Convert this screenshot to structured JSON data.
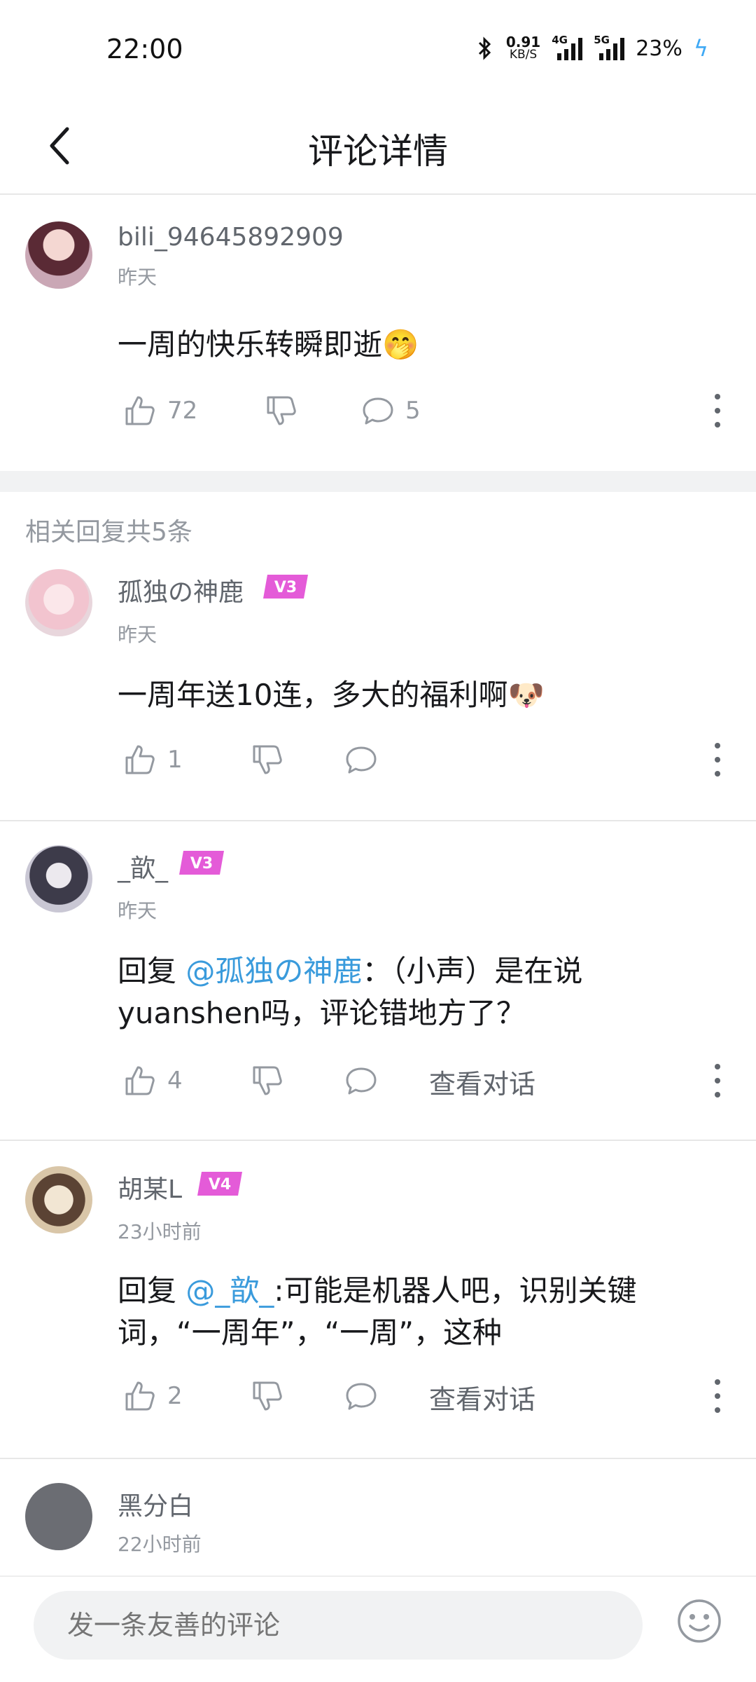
{
  "status_bar": {
    "time": "22:00",
    "net_speed": "0.91",
    "net_unit": "KB/S",
    "sim1": "4G",
    "sim2": "5G",
    "battery": "23%"
  },
  "header": {
    "title": "评论详情"
  },
  "main_comment": {
    "username": "bili_94645892909",
    "time": "昨天",
    "text": "一周的快乐转瞬即逝",
    "emoji": "🤭",
    "likes": "72",
    "replies": "5"
  },
  "section_title": "相关回复共5条",
  "replies": [
    {
      "username": "孤独の神鹿",
      "level": "V3",
      "time": "昨天",
      "text": "一周年送10连，多大的福利啊",
      "emoji": "🐶",
      "likes": "1"
    },
    {
      "username": "_歆_",
      "level": "V3",
      "time": "昨天",
      "reply_prefix": "回复 ",
      "mention": "@孤独の神鹿",
      "text": "：（小声）是在说yuanshen吗，评论错地方了？",
      "likes": "4",
      "view_conversation": "查看对话"
    },
    {
      "username": "胡某L",
      "level": "V4",
      "time": "23小时前",
      "reply_prefix": "回复 ",
      "mention": "@_歆_",
      "text": ":可能是机器人吧，识别关键词，“一周年”，“一周”，这种",
      "likes": "2",
      "view_conversation": "查看对话"
    },
    {
      "username": "黑分白",
      "time": "22小时前"
    }
  ],
  "bottom_bar": {
    "placeholder": "发一条友善的评论"
  },
  "colors": {
    "mention": "#3a9bdc",
    "level_badge": "#e45bd8",
    "divider": "#f1f2f3"
  }
}
